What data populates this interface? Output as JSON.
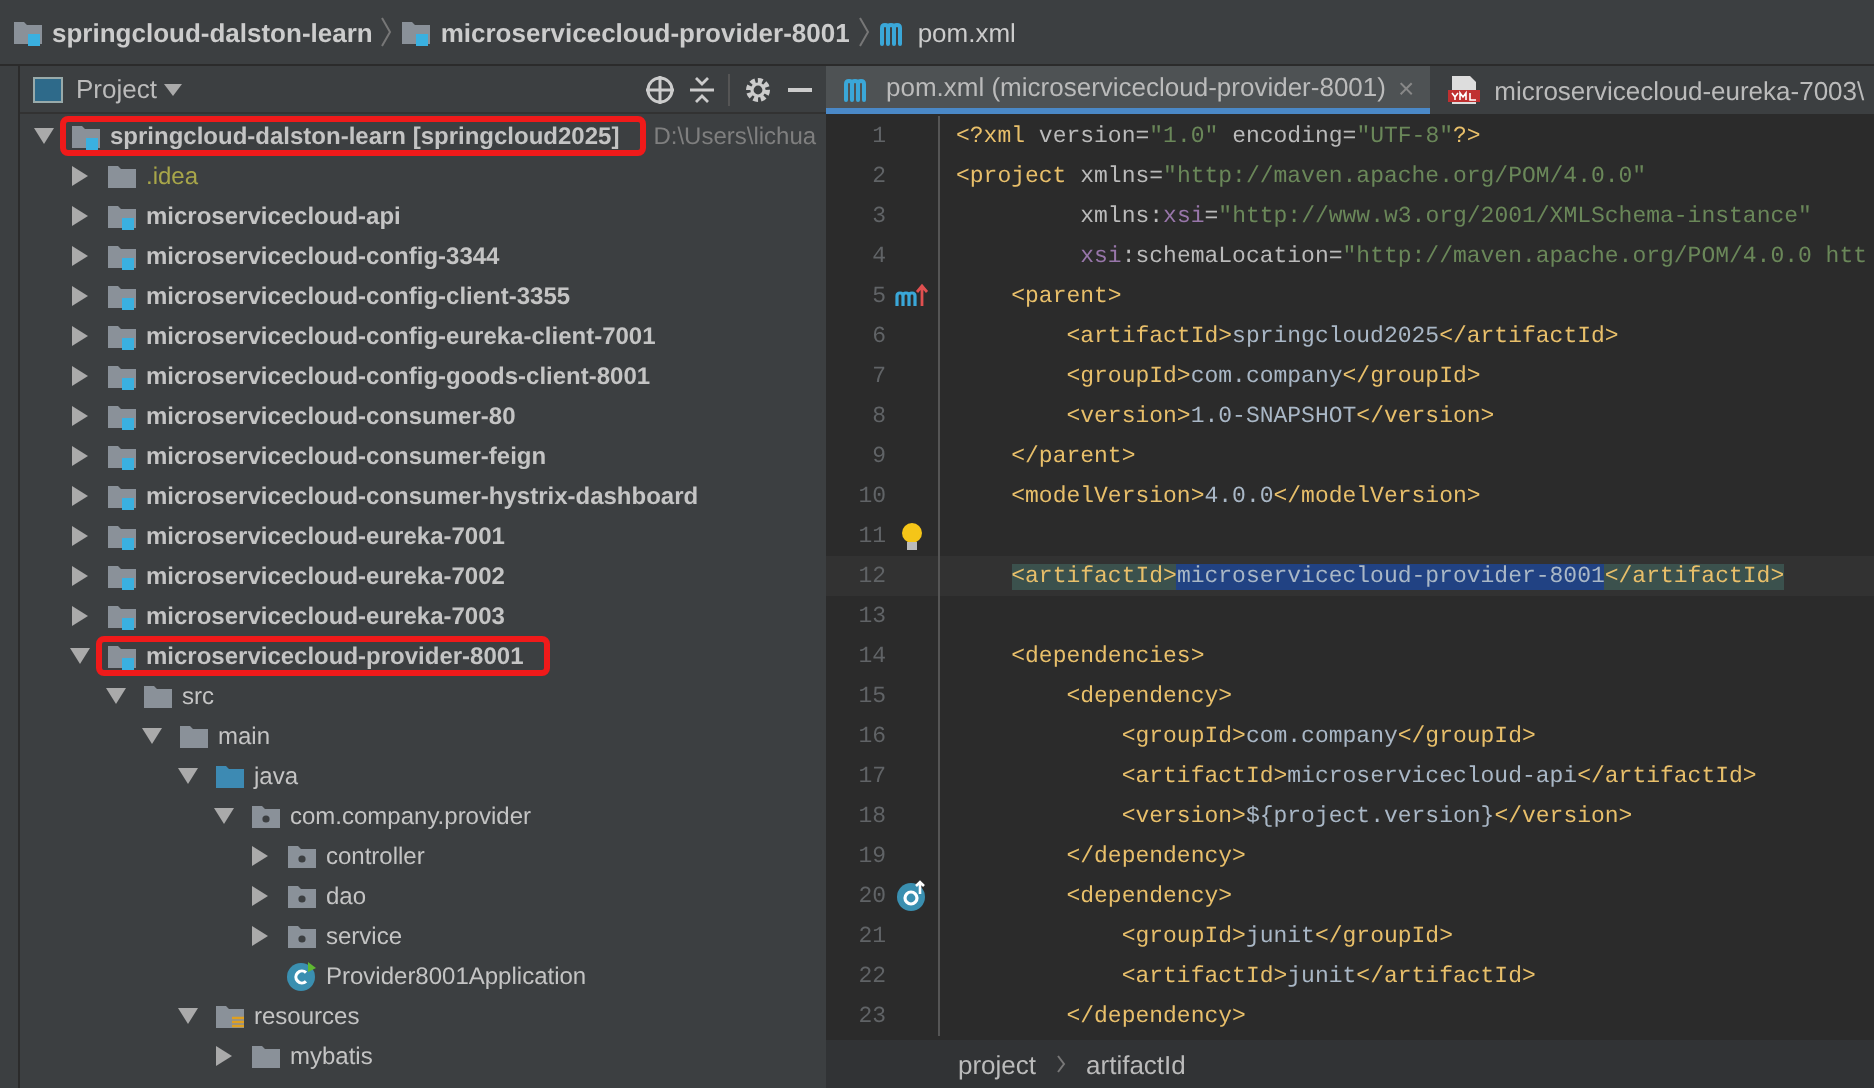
{
  "breadcrumbs": [
    {
      "label": "springcloud-dalston-learn",
      "kind": "module"
    },
    {
      "label": "microservicecloud-provider-8001",
      "kind": "module"
    },
    {
      "label": "pom.xml",
      "kind": "maven"
    }
  ],
  "project_panel": {
    "title": "Project",
    "tree": [
      {
        "label": "springcloud-dalston-learn **[springcloud2025]**",
        "path": "D:\\Users\\lichua",
        "kind": "module",
        "expanded": true,
        "highlighted": true,
        "children": [
          {
            "label": ".idea",
            "kind": "ignored",
            "expanded": false,
            "highlighted": false
          },
          {
            "label": "microservicecloud-api",
            "kind": "module",
            "expanded": false,
            "highlighted": false
          },
          {
            "label": "microservicecloud-config-3344",
            "kind": "module",
            "expanded": false,
            "highlighted": false
          },
          {
            "label": "microservicecloud-config-client-3355",
            "kind": "module",
            "expanded": false,
            "highlighted": false
          },
          {
            "label": "microservicecloud-config-eureka-client-7001",
            "kind": "module",
            "expanded": false,
            "highlighted": false
          },
          {
            "label": "microservicecloud-config-goods-client-8001",
            "kind": "module",
            "expanded": false,
            "highlighted": false
          },
          {
            "label": "microservicecloud-consumer-80",
            "kind": "module",
            "expanded": false,
            "highlighted": false
          },
          {
            "label": "microservicecloud-consumer-feign",
            "kind": "module",
            "expanded": false,
            "highlighted": false
          },
          {
            "label": "microservicecloud-consumer-hystrix-dashboard",
            "kind": "module",
            "expanded": false,
            "highlighted": false
          },
          {
            "label": "microservicecloud-eureka-7001",
            "kind": "module",
            "expanded": false,
            "highlighted": false
          },
          {
            "label": "microservicecloud-eureka-7002",
            "kind": "module",
            "expanded": false,
            "highlighted": false
          },
          {
            "label": "microservicecloud-eureka-7003",
            "kind": "module",
            "expanded": false,
            "highlighted": false
          },
          {
            "label": "microservicecloud-provider-8001",
            "kind": "module",
            "expanded": true,
            "highlighted": true,
            "children": [
              {
                "label": "src",
                "kind": "folder",
                "expanded": true,
                "highlighted": false,
                "children": [
                  {
                    "label": "main",
                    "kind": "folder",
                    "expanded": true,
                    "highlighted": false,
                    "children": [
                      {
                        "label": "java",
                        "kind": "source",
                        "expanded": true,
                        "highlighted": false,
                        "children": [
                          {
                            "label": "com.company.provider",
                            "kind": "package",
                            "expanded": true,
                            "highlighted": false,
                            "children": [
                              {
                                "label": "controller",
                                "kind": "package",
                                "expanded": false,
                                "highlighted": false
                              },
                              {
                                "label": "dao",
                                "kind": "package",
                                "expanded": false,
                                "highlighted": false
                              },
                              {
                                "label": "service",
                                "kind": "package",
                                "expanded": false,
                                "highlighted": false
                              },
                              {
                                "label": "Provider8001Application",
                                "kind": "class",
                                "highlighted": false
                              }
                            ]
                          }
                        ]
                      },
                      {
                        "label": "resources",
                        "kind": "resources",
                        "expanded": true,
                        "highlighted": false,
                        "children": [
                          {
                            "label": "mybatis",
                            "kind": "folder",
                            "expanded": false,
                            "highlighted": false
                          }
                        ]
                      }
                    ]
                  }
                ]
              }
            ]
          }
        ]
      }
    ]
  },
  "editor": {
    "tabs": [
      {
        "label": "pom.xml (microservicecloud-provider-8001)",
        "kind": "maven",
        "selected": true,
        "close": "×"
      },
      {
        "label": "microservicecloud-eureka-7003\\",
        "kind": "yml",
        "selected": false
      }
    ],
    "lines": [
      {
        "number": "1",
        "tokens": [
          {
            "kind": "tag",
            "text": "<?xml "
          },
          {
            "kind": "attr",
            "text": "version="
          },
          {
            "kind": "value",
            "text": "\"1.0\" "
          },
          {
            "kind": "attr",
            "text": "encoding="
          },
          {
            "kind": "value",
            "text": "\"UTF-8\""
          },
          {
            "kind": "tag",
            "text": "?>"
          }
        ]
      },
      {
        "number": "2",
        "tokens": [
          {
            "kind": "tag",
            "text": "<project "
          },
          {
            "kind": "attr",
            "text": "xmlns="
          },
          {
            "kind": "value",
            "text": "\"http://maven.apache.org/POM/4.0.0\""
          }
        ]
      },
      {
        "number": "3",
        "tokens": [
          {
            "kind": "attr",
            "text": "         xmlns:"
          },
          {
            "kind": "ns",
            "text": "xsi"
          },
          {
            "kind": "attr",
            "text": "="
          },
          {
            "kind": "value",
            "text": "\"http://www.w3.org/2001/XMLSchema-instance\""
          }
        ]
      },
      {
        "number": "4",
        "tokens": [
          {
            "kind": "ns",
            "text": "         xsi"
          },
          {
            "kind": "attr",
            "text": ":schemaLocation="
          },
          {
            "kind": "value",
            "text": "\"http://maven.apache.org/POM/4.0.0 htt"
          }
        ]
      },
      {
        "number": "5",
        "gutter": {
          "kind": "maven-parent"
        },
        "tokens": [
          {
            "kind": "tag",
            "text": "    <parent>"
          }
        ]
      },
      {
        "number": "6",
        "tokens": [
          {
            "kind": "tag",
            "text": "        <artifactId>"
          },
          {
            "kind": "text",
            "text": "springcloud2025"
          },
          {
            "kind": "tag",
            "text": "</artifactId>"
          }
        ]
      },
      {
        "number": "7",
        "tokens": [
          {
            "kind": "tag",
            "text": "        <groupId>"
          },
          {
            "kind": "text",
            "text": "com.company"
          },
          {
            "kind": "tag",
            "text": "</groupId>"
          }
        ]
      },
      {
        "number": "8",
        "tokens": [
          {
            "kind": "tag",
            "text": "        <version>"
          },
          {
            "kind": "text",
            "text": "1.0-SNAPSHOT"
          },
          {
            "kind": "tag",
            "text": "</version>"
          }
        ]
      },
      {
        "number": "9",
        "tokens": [
          {
            "kind": "tag",
            "text": "    </parent>"
          }
        ]
      },
      {
        "number": "10",
        "tokens": [
          {
            "kind": "tag",
            "text": "    <modelVersion>"
          },
          {
            "kind": "text",
            "text": "4.0.0"
          },
          {
            "kind": "tag",
            "text": "</modelVersion>"
          }
        ]
      },
      {
        "number": "11",
        "gutter": {
          "kind": "bulb"
        }
      },
      {
        "number": "12",
        "current": true,
        "tokens": [
          {
            "kind": "tag",
            "text": "    <artifactId>",
            "match": true
          },
          {
            "kind": "text",
            "text": "microservicecloud-provider-8001",
            "selected": true
          },
          {
            "kind": "tag",
            "text": "</artifactId>",
            "match": true
          }
        ]
      },
      {
        "number": "13"
      },
      {
        "number": "14",
        "tokens": [
          {
            "kind": "tag",
            "text": "    <dependencies>"
          }
        ]
      },
      {
        "number": "15",
        "tokens": [
          {
            "kind": "tag",
            "text": "        <dependency>"
          }
        ]
      },
      {
        "number": "16",
        "tokens": [
          {
            "kind": "tag",
            "text": "            <groupId>"
          },
          {
            "kind": "text",
            "text": "com.company"
          },
          {
            "kind": "tag",
            "text": "</groupId>"
          }
        ]
      },
      {
        "number": "17",
        "tokens": [
          {
            "kind": "tag",
            "text": "            <artifactId>"
          },
          {
            "kind": "text",
            "text": "microservicecloud-api"
          },
          {
            "kind": "tag",
            "text": "</artifactId>"
          }
        ]
      },
      {
        "number": "18",
        "tokens": [
          {
            "kind": "tag",
            "text": "            <version>"
          },
          {
            "kind": "text",
            "text": "${project.version}"
          },
          {
            "kind": "tag",
            "text": "</version>"
          }
        ]
      },
      {
        "number": "19",
        "tokens": [
          {
            "kind": "tag",
            "text": "        </dependency>"
          }
        ]
      },
      {
        "number": "20",
        "gutter": {
          "kind": "override"
        },
        "tokens": [
          {
            "kind": "tag",
            "text": "        <dependency>"
          }
        ]
      },
      {
        "number": "21",
        "tokens": [
          {
            "kind": "tag",
            "text": "            <groupId>"
          },
          {
            "kind": "text",
            "text": "junit"
          },
          {
            "kind": "tag",
            "text": "</groupId>"
          }
        ]
      },
      {
        "number": "22",
        "tokens": [
          {
            "kind": "tag",
            "text": "            <artifactId>"
          },
          {
            "kind": "text",
            "text": "junit"
          },
          {
            "kind": "tag",
            "text": "</artifactId>"
          }
        ]
      },
      {
        "number": "23",
        "tokens": [
          {
            "kind": "tag",
            "text": "        </dependency>"
          }
        ]
      }
    ],
    "breadcrumbs": [
      "project",
      "artifactId"
    ]
  }
}
